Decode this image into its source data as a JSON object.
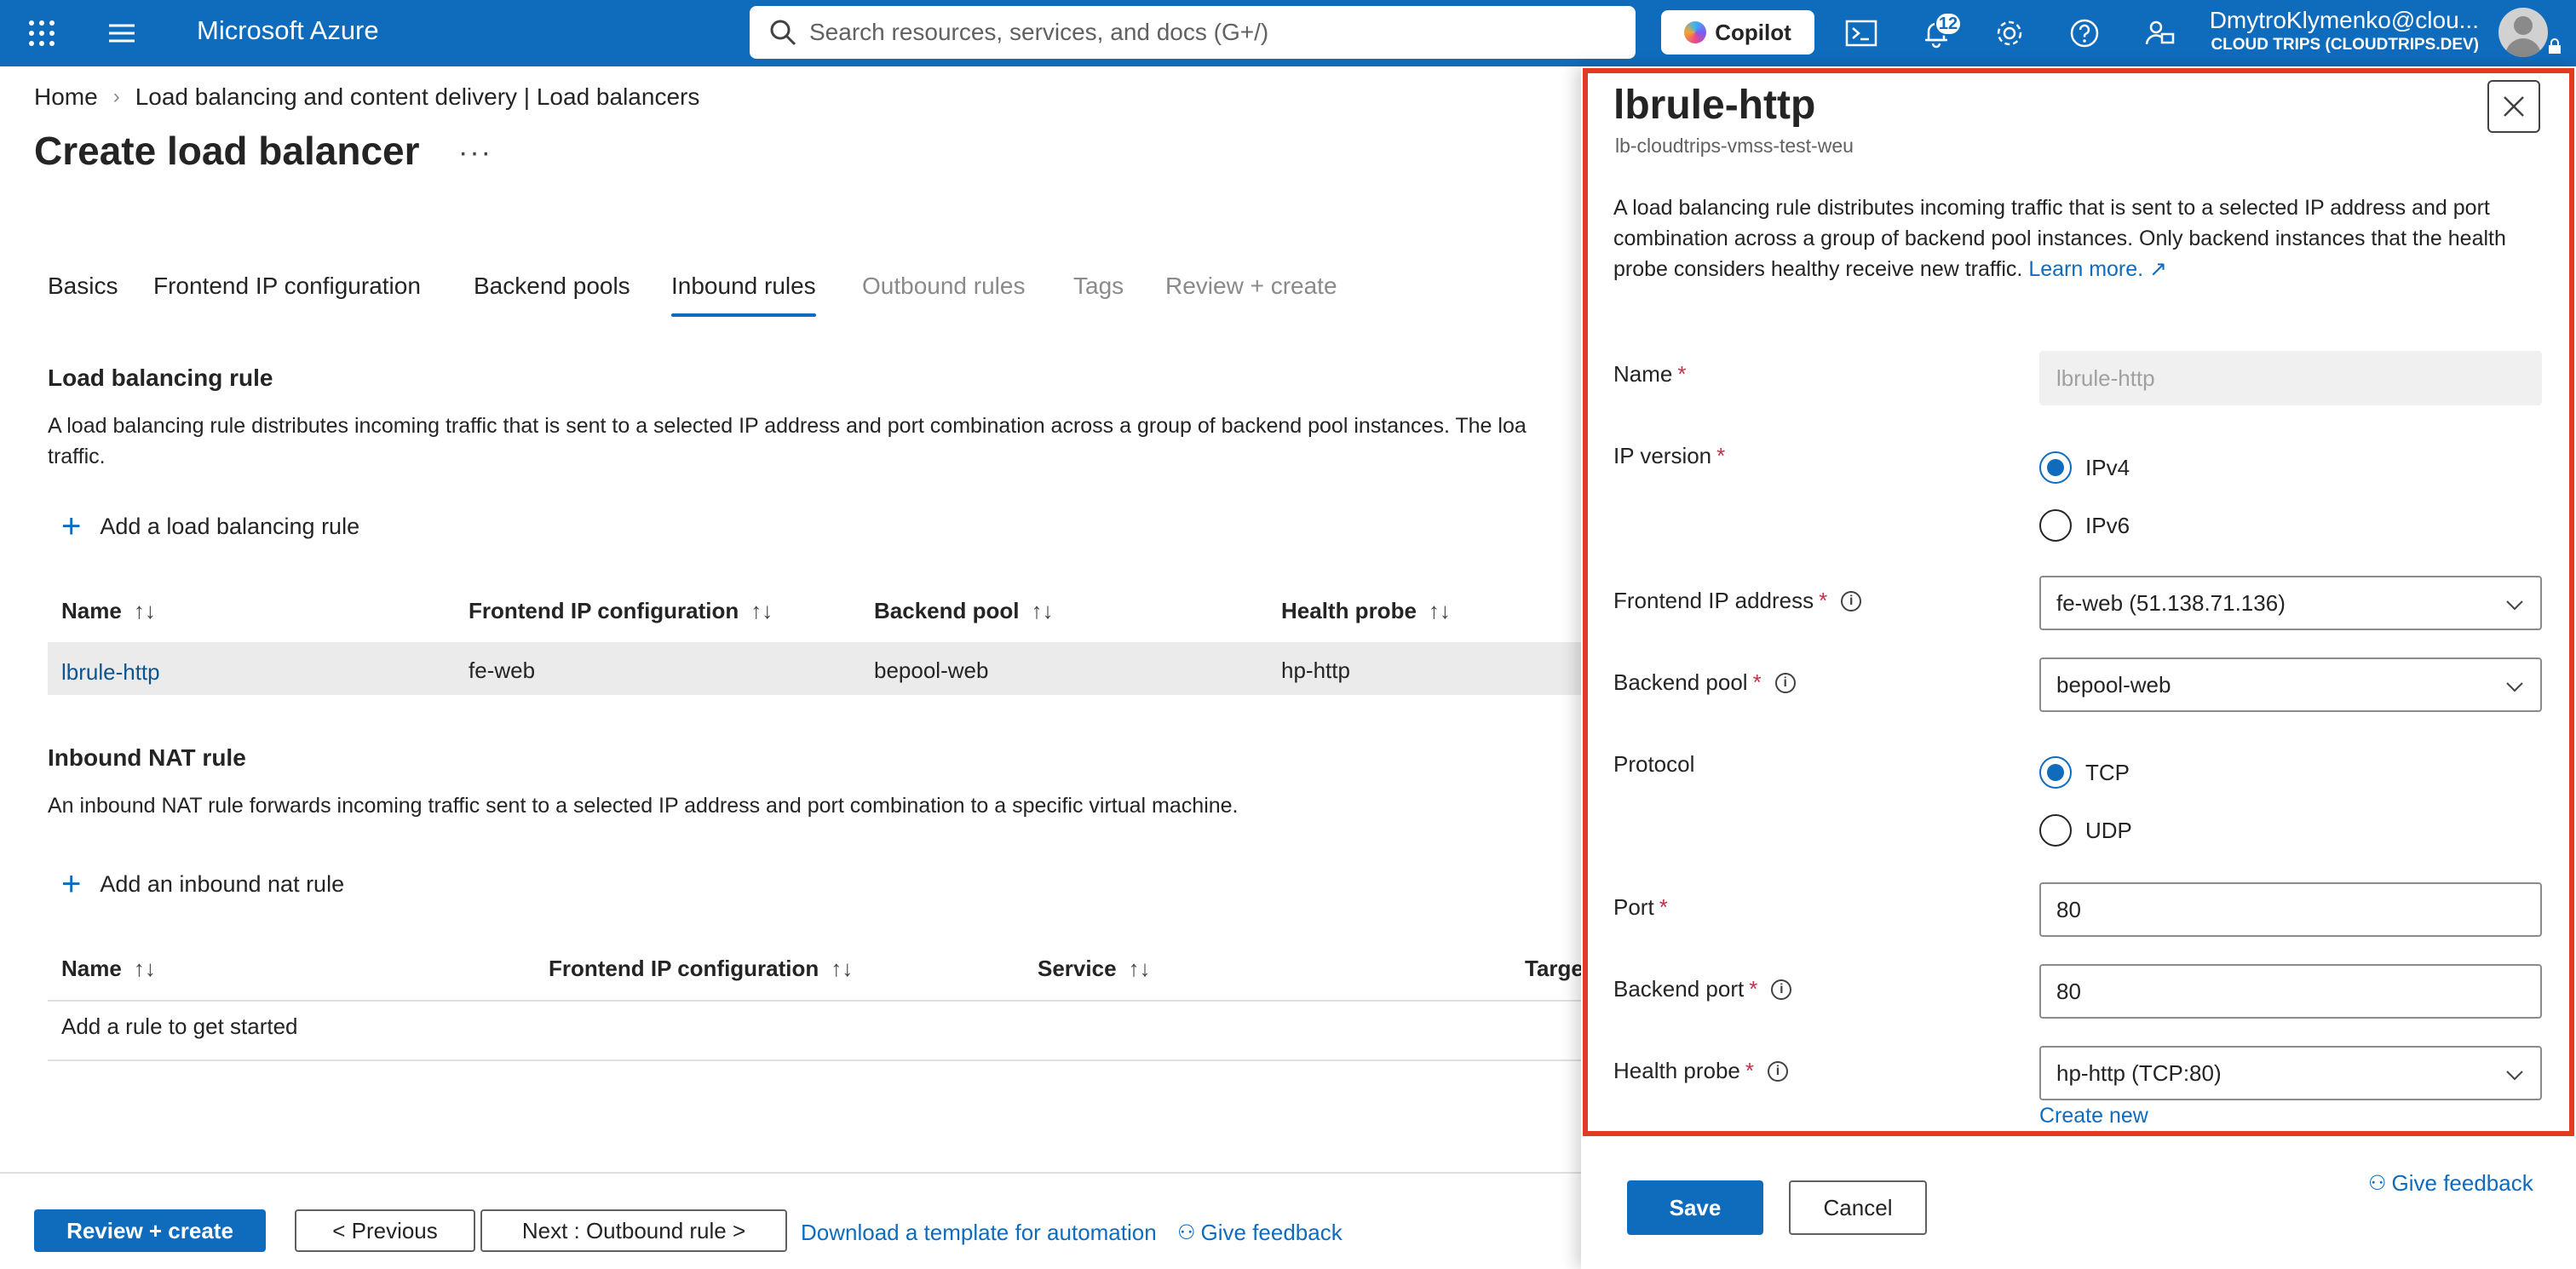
{
  "topbar": {
    "brand": "Microsoft Azure",
    "search_placeholder": "Search resources, services, and docs (G+/)",
    "copilot_label": "Copilot",
    "notification_count": "12",
    "user": "DmytroKlymenko@clou...",
    "directory": "CLOUD TRIPS (CLOUDTRIPS.DEV)"
  },
  "breadcrumb": {
    "home": "Home",
    "parent": "Load balancing and content delivery | Load balancers"
  },
  "page": {
    "title": "Create load balancer",
    "more": "···"
  },
  "tabs": [
    {
      "label": "Basics"
    },
    {
      "label": "Frontend IP configuration"
    },
    {
      "label": "Backend pools"
    },
    {
      "label": "Inbound rules"
    },
    {
      "label": "Outbound rules"
    },
    {
      "label": "Tags"
    },
    {
      "label": "Review + create"
    }
  ],
  "lb_rule": {
    "title": "Load balancing rule",
    "description_line1": "A load balancing rule distributes incoming traffic that is sent to a selected IP address and port combination across a group of backend pool instances. The loa",
    "description_line2": "traffic.",
    "add_label": "Add a load balancing rule",
    "columns": [
      "Name",
      "Frontend IP configuration",
      "Backend pool",
      "Health probe"
    ],
    "rows": [
      {
        "name": "lbrule-http",
        "frontend": "fe-web",
        "backend": "bepool-web",
        "probe": "hp-http"
      }
    ]
  },
  "nat_rule": {
    "title": "Inbound NAT rule",
    "description": "An inbound NAT rule forwards incoming traffic sent to a selected IP address and port combination to a specific virtual machine.",
    "add_label": "Add an inbound nat rule",
    "columns": [
      "Name",
      "Frontend IP configuration",
      "Service",
      "Targe"
    ],
    "empty": "Add a rule to get started"
  },
  "bottom": {
    "review_create": "Review + create",
    "previous": "< Previous",
    "next": "Next : Outbound rule >",
    "download": "Download a template for automation",
    "feedback": "Give feedback"
  },
  "panel": {
    "title": "lbrule-http",
    "subtitle": "lb-cloudtrips-vmss-test-weu",
    "description": "A load balancing rule distributes incoming traffic that is sent to a selected IP address and port combination across a group of backend pool instances. Only backend instances that the health probe considers healthy receive new traffic.",
    "learn_more": "Learn more.",
    "name_label": "Name",
    "name_value": "lbrule-http",
    "ip_version_label": "IP version",
    "ipv4": "IPv4",
    "ipv6": "IPv6",
    "frontend_label": "Frontend IP address",
    "frontend_value": "fe-web (51.138.71.136)",
    "backend_pool_label": "Backend pool",
    "backend_pool_value": "bepool-web",
    "protocol_label": "Protocol",
    "tcp": "TCP",
    "udp": "UDP",
    "port_label": "Port",
    "port_value": "80",
    "backend_port_label": "Backend port",
    "backend_port_value": "80",
    "health_probe_label": "Health probe",
    "health_probe_value": "hp-http (TCP:80)",
    "create_new": "Create new",
    "save": "Save",
    "cancel": "Cancel",
    "give_feedback": "Give feedback",
    "required_mark": "*"
  }
}
